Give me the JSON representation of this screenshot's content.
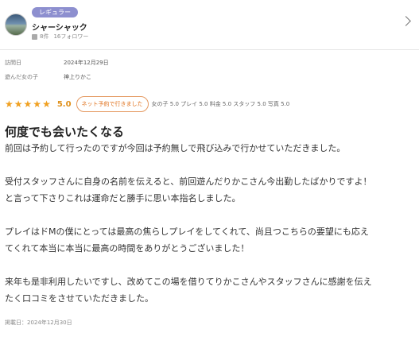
{
  "reviewer": {
    "badge": "レギュラー",
    "name": "シャーシャック",
    "review_count": "8件",
    "followers": "16フォロワー"
  },
  "info": {
    "visit_date_label": "訪問日",
    "visit_date": "2024年12月29日",
    "girl_label": "遊んだ女の子",
    "girl_name": "神上りかこ"
  },
  "rating": {
    "stars": 5,
    "overall": "5.0",
    "non_adv_badge": "ネット予約で行きました",
    "subscores_text": "女の子 5.0 プレイ 5.0 料金 5.0 スタッフ 5.0 写真 5.0"
  },
  "review": {
    "title": "何度でも会いたくなる",
    "p1": "前回は予約して行ったのですが今回は予約無しで飛び込みで行かせていただきました。",
    "p2": "受付スタッフさんに自身の名前を伝えると、前回遊んだりかこさん今出勤したばかりですよ！\nと言って下さりこれは運命だと勝手に思い本指名しました。",
    "p3": "プレイはドMの僕にとっては最高の焦らしプレイをしてくれて、尚且つこちらの要望にも応え\nてくれて本当に本当に最高の時間をありがとうございました！",
    "p4": "来年も是非利用したいですし、改めてこの場を借りてりかこさんやスタッフさんに感謝を伝え\nたく口コミをさせていただきました。",
    "posted": "掲載日：2024年12月30日"
  },
  "colors": {
    "badge": "#8d8fcf",
    "star": "#f0a020",
    "accent": "#e0701a"
  },
  "icons": {
    "reviewer_avatar": "avatar-image",
    "chevron": "chevron-right-icon",
    "star": "star-icon",
    "review_count": "review-count-icon"
  }
}
